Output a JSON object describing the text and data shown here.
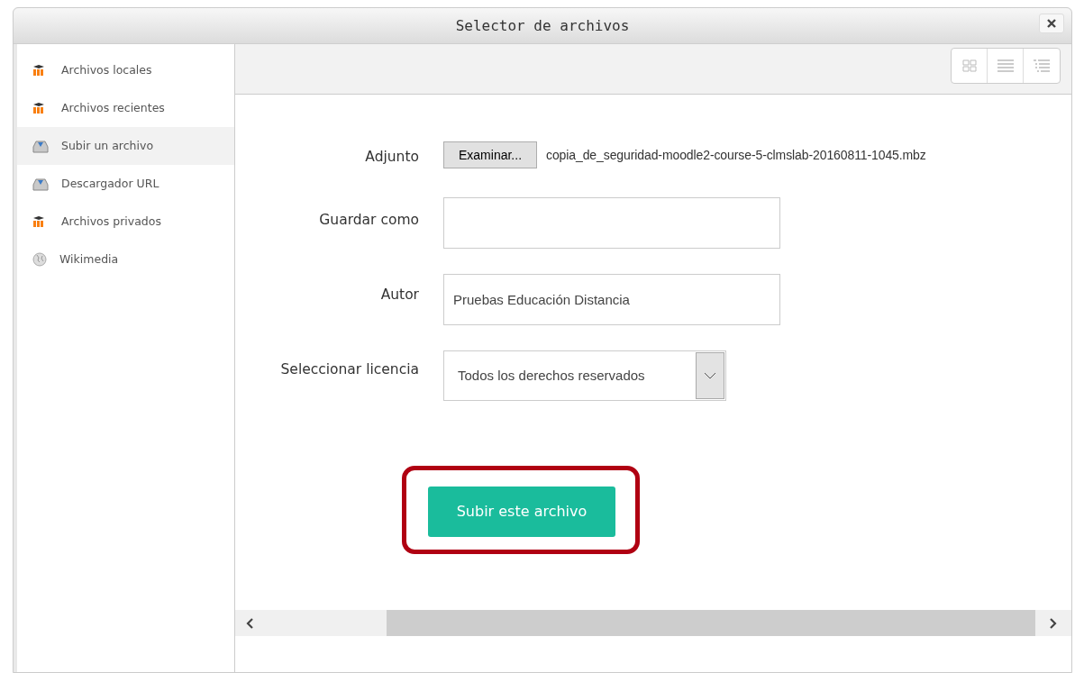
{
  "window": {
    "title": "Selector de archivos"
  },
  "sidebar": {
    "items": [
      {
        "label": "Archivos locales",
        "kind": "moodle",
        "selected": false
      },
      {
        "label": "Archivos recientes",
        "kind": "moodle",
        "selected": false
      },
      {
        "label": "Subir un archivo",
        "kind": "upload",
        "selected": true
      },
      {
        "label": "Descargador URL",
        "kind": "upload",
        "selected": false
      },
      {
        "label": "Archivos privados",
        "kind": "moodle",
        "selected": false
      },
      {
        "label": "Wikimedia",
        "kind": "wiki",
        "selected": false
      }
    ]
  },
  "form": {
    "attachment": {
      "label": "Adjunto",
      "button": "Examinar...",
      "file": "copia_de_seguridad-moodle2-course-5-clmslab-20160811-1045.mbz"
    },
    "save_as": {
      "label": "Guardar como"
    },
    "author": {
      "label": "Autor",
      "value": "Pruebas Educación Distancia"
    },
    "license": {
      "label": "Seleccionar licencia",
      "value": "Todos los derechos reservados"
    },
    "submit": {
      "label": "Subir este archivo",
      "highlighted": true
    }
  }
}
